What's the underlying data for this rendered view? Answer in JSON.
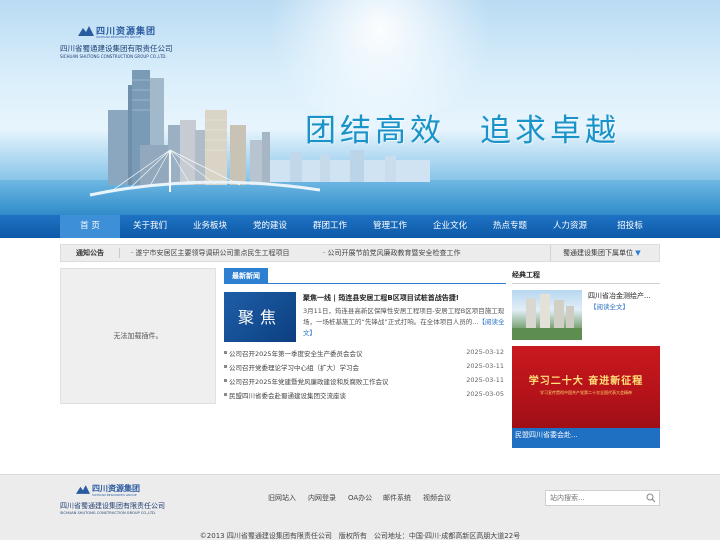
{
  "header": {
    "logo_cn_top": "四川资源集团",
    "logo_en_top": "SICHUAN RESOURCES GROUP",
    "company_cn": "四川省蜀通建设集团有限责任公司",
    "company_en": "SICHUAN SHUTONG CONSTRUCTION GROUP CO.,LTD.",
    "slogan": "团结高效　追求卓越"
  },
  "nav": {
    "items": [
      {
        "label": "首 页",
        "active": true
      },
      {
        "label": "关于我们"
      },
      {
        "label": "业务板块"
      },
      {
        "label": "党的建设"
      },
      {
        "label": "群团工作"
      },
      {
        "label": "管理工作"
      },
      {
        "label": "企业文化"
      },
      {
        "label": "热点专题"
      },
      {
        "label": "人力资源"
      },
      {
        "label": "招投标"
      }
    ]
  },
  "notice": {
    "label": "通知公告",
    "items": [
      "· 遂宁市安居区主要领导调研公司重点民生工程项目",
      "· 公司开展节前党风廉政教育暨安全检查工作"
    ],
    "right_label": "蜀通建设集团下属单位"
  },
  "left_panel": {
    "message": "无法加载插件。"
  },
  "news": {
    "tab_label": "最新新闻",
    "feature": {
      "image_text": "聚焦",
      "title": "聚焦一线 | 筠连县安居工程B区项目试桩首战告捷!",
      "text": "3月11日，筠连县高新区保障性安居工程项目-安居工程B区项目施工现场，一场桩基施工的“先锋战”正式打响。在全体项目人员的...",
      "link": "【阅读全文】"
    },
    "list": [
      {
        "title": "公司召开2025年第一季度安全生产委员会会议",
        "date": "2025-03-12"
      },
      {
        "title": "公司召开党委理论学习中心组（扩大）学习会",
        "date": "2025-03-11"
      },
      {
        "title": "公司召开2025年党建暨党风廉政建设和反腐败工作会议",
        "date": "2025-03-11"
      },
      {
        "title": "民盟四川省委会赴蜀通建设集团交流座谈",
        "date": "2025-03-05"
      }
    ]
  },
  "projects": {
    "heading": "经典工程",
    "item1_title": "四川省冶金测绘产...",
    "item1_link": "【阅读全文】",
    "item2_big": "学习二十大  奋进新征程",
    "item2_small": "学习宣传贯彻中国共产党第二十次全国代表大会精神",
    "item2_caption": "民盟四川省委会赴..."
  },
  "footer": {
    "logo_cn_top": "四川资源集团",
    "logo_en_top": "SICHUAN RESOURCES GROUP",
    "company_cn": "四川省蜀通建设集团有限责任公司",
    "company_en": "SICHUAN SHUTONG CONSTRUCTION GROUP CO.,LTD.",
    "links": [
      "旧网站入",
      "内网登录",
      "OA办公",
      "邮件系统",
      "视频会议"
    ],
    "search_placeholder": "站内搜索...",
    "copyright": "©2013 四川省蜀通建设集团有限责任公司　版权所有　公司地址：中国·四川·成都高新区高朋大道22号"
  },
  "colors": {
    "nav_blue": "#0d59a8",
    "nav_active": "#3d8fd8",
    "accent_blue": "#2d7fd1",
    "slogan": "#1a93c9",
    "project_red": "#c8191e"
  }
}
